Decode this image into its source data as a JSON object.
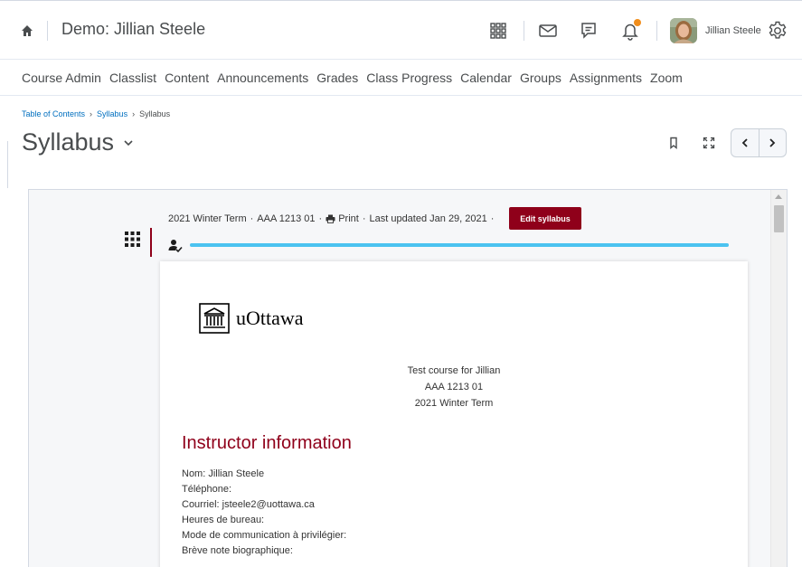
{
  "header": {
    "org_title": "Demo: Jillian Steele",
    "user_name": "Jillian Steele",
    "notification_dot_color": "#f18e1c"
  },
  "nav": {
    "items": [
      "Course Admin",
      "Classlist",
      "Content",
      "Announcements",
      "Grades",
      "Class Progress",
      "Calendar",
      "Groups",
      "Assignments",
      "Zoom"
    ]
  },
  "breadcrumb": {
    "items": [
      "Table of Contents",
      "Syllabus",
      "Syllabus"
    ]
  },
  "page": {
    "title": "Syllabus"
  },
  "syllabus": {
    "term": "2021 Winter Term",
    "course_code": "AAA 1213 01",
    "print_label": "Print",
    "last_updated": "Last updated Jan 29, 2021",
    "edit_button": "Edit syllabus",
    "progress_fraction": 1.0,
    "brand_color": "#8f001a",
    "progress_color": "#4bc3f0",
    "logo_text": "uOttawa",
    "course_lines": [
      "Test course for Jillian",
      "AAA 1213 01",
      "2021 Winter Term"
    ],
    "section_heading": "Instructor information",
    "info_lines": [
      "Nom: Jillian Steele",
      "Téléphone:",
      "Courriel: jsteele2@uottawa.ca",
      "Heures de bureau:",
      "Mode de communication à privilégier:",
      "Brève note biographique:"
    ]
  },
  "icons": [
    "home-icon",
    "app-grid-icon",
    "mail-icon",
    "chat-icon",
    "bell-icon",
    "gear-icon",
    "chevron-down-icon",
    "bookmark-icon",
    "fullscreen-icon",
    "chevron-left-icon",
    "chevron-right-icon",
    "printer-icon",
    "grid-dots-icon",
    "person-check-icon",
    "university-logo-icon"
  ]
}
